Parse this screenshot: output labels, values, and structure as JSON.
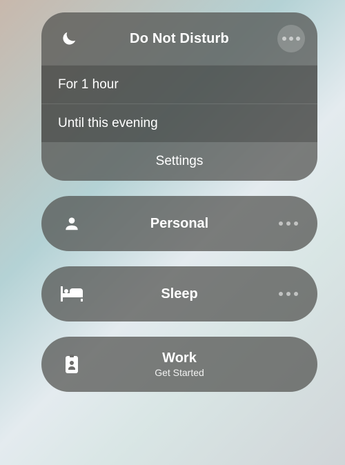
{
  "dnd": {
    "title": "Do Not Disturb",
    "options": [
      "For 1 hour",
      "Until this evening"
    ],
    "settings": "Settings"
  },
  "modes": [
    {
      "id": "personal",
      "label": "Personal",
      "sub": "",
      "icon": "person",
      "more": true
    },
    {
      "id": "sleep",
      "label": "Sleep",
      "sub": "",
      "icon": "bed",
      "more": true
    },
    {
      "id": "work",
      "label": "Work",
      "sub": "Get Started",
      "icon": "badge",
      "more": false
    }
  ]
}
